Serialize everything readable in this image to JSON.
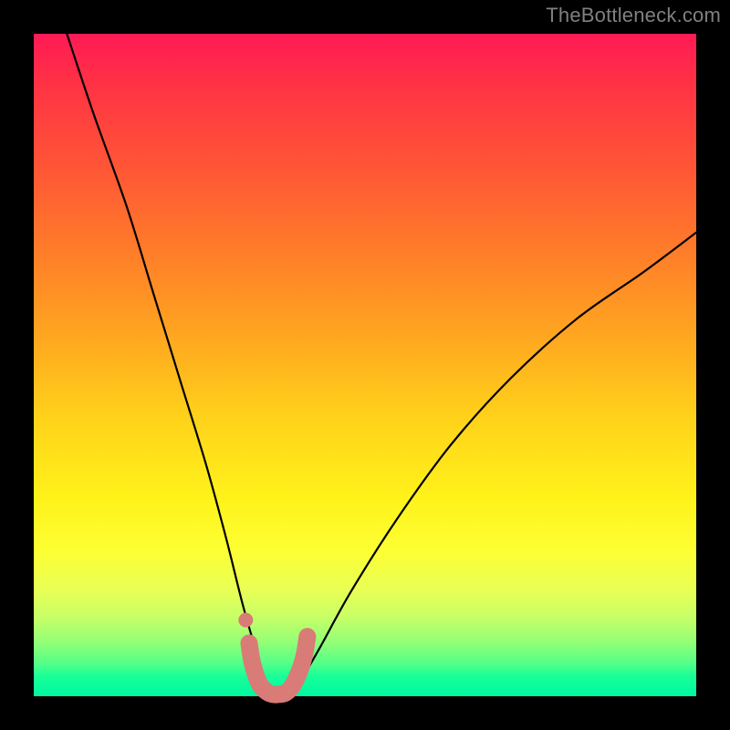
{
  "watermark": "TheBottleneck.com",
  "chart_data": {
    "type": "line",
    "title": "",
    "xlabel": "",
    "ylabel": "",
    "xlim": [
      0,
      100
    ],
    "ylim": [
      0,
      100
    ],
    "grid": false,
    "series": [
      {
        "name": "bottleneck-curve",
        "color": "#000000",
        "x": [
          5,
          9,
          14,
          18,
          22,
          26,
          29,
          31.5,
          33.5,
          35,
          36,
          38,
          40,
          43,
          48,
          55,
          63,
          72,
          82,
          92,
          100
        ],
        "y": [
          100,
          88,
          74,
          61,
          48,
          35,
          24,
          14,
          7,
          2,
          0.3,
          0.3,
          2,
          7,
          16,
          27,
          38,
          48,
          57,
          64,
          70
        ]
      },
      {
        "name": "highlight-bottom",
        "color": "#d97b77",
        "x": [
          32.5,
          33,
          34,
          35,
          36,
          37,
          38,
          39,
          40,
          40.8,
          41.3
        ],
        "y": [
          8,
          5,
          2,
          0.8,
          0.3,
          0.3,
          0.5,
          1.5,
          3.5,
          6,
          9
        ]
      },
      {
        "name": "highlight-dot",
        "color": "#d97b77",
        "x": [
          32
        ],
        "y": [
          11.5
        ]
      }
    ],
    "gradient_colors": {
      "top": "#ff1a55",
      "mid_upper": "#ff7a2a",
      "mid": "#fff21a",
      "mid_lower": "#c8ff66",
      "bottom": "#00f7a0"
    },
    "annotations": []
  }
}
